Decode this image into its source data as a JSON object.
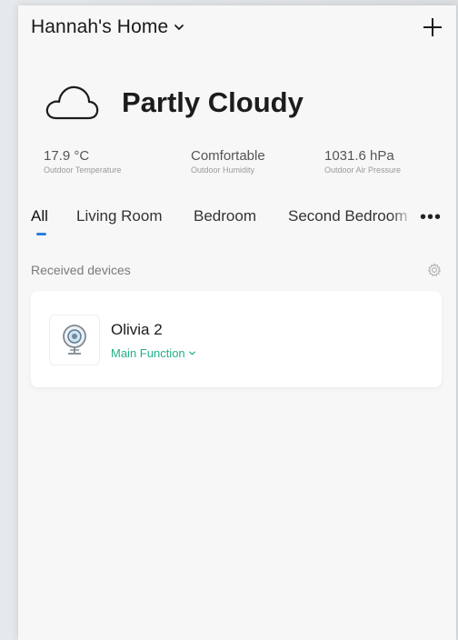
{
  "header": {
    "home_name": "Hannah's Home",
    "add_icon": "plus-icon",
    "dropdown_icon": "chevron-down-icon"
  },
  "weather": {
    "icon": "cloud-icon",
    "condition": "Partly Cloudy",
    "stats": [
      {
        "value": "17.9 °C",
        "label": "Outdoor Temperature"
      },
      {
        "value": "Comfortable",
        "label": "Outdoor Humidity"
      },
      {
        "value": "1031.6 hPa",
        "label": "Outdoor Air Pressure"
      }
    ]
  },
  "tabs": {
    "items": [
      {
        "label": "All",
        "active": true
      },
      {
        "label": "Living Room",
        "active": false
      },
      {
        "label": "Bedroom",
        "active": false
      },
      {
        "label": "Second Bedroom",
        "active": false
      }
    ],
    "more_icon": "more-dots-icon",
    "active_color": "#2b7fe0"
  },
  "section": {
    "title": "Received devices",
    "settings_icon": "gear-icon"
  },
  "devices": [
    {
      "name": "Olivia 2",
      "function_label": "Main Function",
      "icon": "camera-icon",
      "function_color": "#24b08a"
    }
  ]
}
